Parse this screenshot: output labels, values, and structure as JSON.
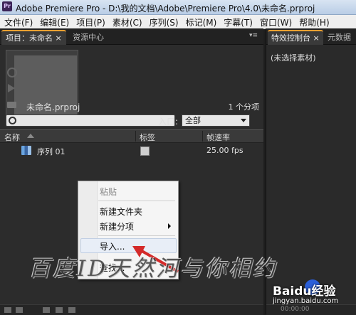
{
  "window": {
    "logo_text": "Pr",
    "title": "Adobe Premiere Pro - D:\\我的文档\\Adobe\\Premiere Pro\\4.0\\未命名.prproj"
  },
  "menubar": {
    "items": [
      "文件(F)",
      "编辑(E)",
      "项目(P)",
      "素材(C)",
      "序列(S)",
      "标记(M)",
      "字幕(T)",
      "窗口(W)",
      "帮助(H)"
    ]
  },
  "project_panel": {
    "tabs": [
      "项目：未命名 ×",
      "资源中心"
    ],
    "project_file": "未命名.prproj",
    "item_count": "1 个分项",
    "search": {
      "placeholder": "",
      "value": ""
    },
    "entry": {
      "label": "入口:",
      "value": "全部"
    },
    "columns": [
      "名称",
      "标签",
      "帧速率"
    ],
    "rows": [
      {
        "name": "序列 01",
        "label_color": "#cfcfcf",
        "frame_rate": "25.00 fps"
      }
    ]
  },
  "context_menu": {
    "items": [
      {
        "label": "粘贴",
        "enabled": false
      },
      {
        "label": "新建文件夹",
        "enabled": true
      },
      {
        "label": "新建分项",
        "enabled": true,
        "has_submenu": true
      },
      {
        "label": "导入...",
        "enabled": true,
        "highlighted": true
      },
      {
        "label": "查找...",
        "enabled": true
      }
    ]
  },
  "effects_panel": {
    "tabs": [
      "特效控制台 ×",
      "元数据"
    ],
    "no_clip_text": "(未选择素材)",
    "timecode": "00:00:00"
  },
  "watermark": {
    "text": "百度ID天然河与你相约",
    "brand": "Baidu经验",
    "url": "jingyan.baidu.com"
  },
  "colors": {
    "accent_tab": "#f0a030",
    "panel_bg": "#2c2c2c",
    "menu_bg": "#f5f5f5",
    "annotation_arrow": "#d42a2a"
  }
}
